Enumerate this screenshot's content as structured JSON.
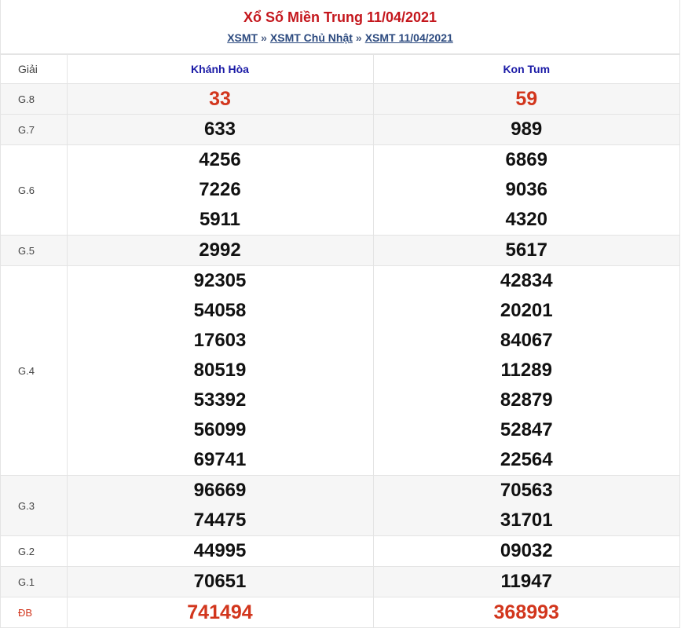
{
  "header": {
    "title": "Xổ Số Miền Trung 11/04/2021",
    "breadcrumb": [
      "XSMT",
      "»",
      "XSMT Chủ Nhật",
      "»",
      "XSMT 11/04/2021"
    ]
  },
  "table": {
    "label_header": "Giải",
    "provinces": [
      "Khánh Hòa",
      "Kon Tum"
    ],
    "prizes": {
      "g8": {
        "label": "G.8",
        "col1": [
          "33"
        ],
        "col2": [
          "59"
        ]
      },
      "g7": {
        "label": "G.7",
        "col1": [
          "633"
        ],
        "col2": [
          "989"
        ]
      },
      "g6": {
        "label": "G.6",
        "col1": [
          "4256",
          "7226",
          "5911"
        ],
        "col2": [
          "6869",
          "9036",
          "4320"
        ]
      },
      "g5": {
        "label": "G.5",
        "col1": [
          "2992"
        ],
        "col2": [
          "5617"
        ]
      },
      "g4": {
        "label": "G.4",
        "col1": [
          "92305",
          "54058",
          "17603",
          "80519",
          "53392",
          "56099",
          "69741"
        ],
        "col2": [
          "42834",
          "20201",
          "84067",
          "11289",
          "82879",
          "52847",
          "22564"
        ]
      },
      "g3": {
        "label": "G.3",
        "col1": [
          "96669",
          "74475"
        ],
        "col2": [
          "70563",
          "31701"
        ]
      },
      "g2": {
        "label": "G.2",
        "col1": [
          "44995"
        ],
        "col2": [
          "09032"
        ]
      },
      "g1": {
        "label": "G.1",
        "col1": [
          "70651"
        ],
        "col2": [
          "11947"
        ]
      },
      "db": {
        "label": "ĐB",
        "col1": [
          "741494"
        ],
        "col2": [
          "368993"
        ]
      }
    }
  },
  "colors": {
    "title": "#c4161c",
    "province": "#1a1aa6",
    "highlight": "#d2361d",
    "link": "#2c4a7f"
  }
}
